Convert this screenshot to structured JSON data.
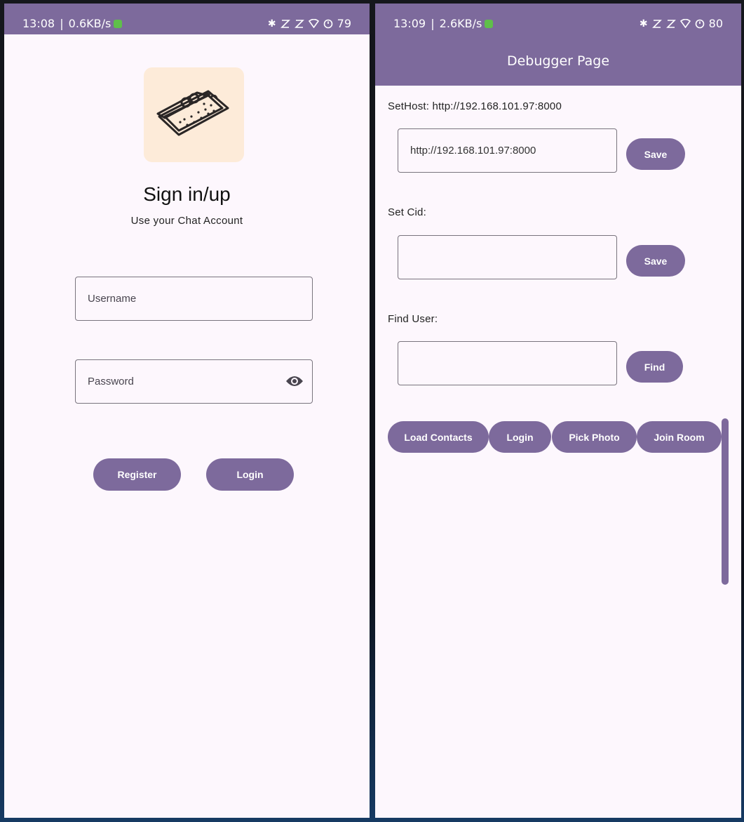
{
  "left_screen": {
    "status": {
      "time": "13:08",
      "speed": "0.6KB/s",
      "battery": "79"
    },
    "title": "Sign in/up",
    "subtitle": "Use your Chat Account",
    "username_placeholder": "Username",
    "password_placeholder": "Password",
    "buttons": {
      "register": "Register",
      "login": "Login"
    }
  },
  "right_screen": {
    "status": {
      "time": "13:09",
      "speed": "2.6KB/s",
      "battery": "80"
    },
    "appbar_title": "Debugger Page",
    "set_host": {
      "label": "SetHost: http://192.168.101.97:8000",
      "value": "http://192.168.101.97:8000",
      "button": "Save"
    },
    "set_cid": {
      "label": "Set Cid:",
      "value": "",
      "button": "Save"
    },
    "find_user": {
      "label": "Find User:",
      "value": "",
      "button": "Find"
    },
    "actions": [
      "Load Contacts",
      "Login",
      "Pick Photo",
      "Join Room"
    ]
  },
  "colors": {
    "primary": "#7d6a9c",
    "background": "#fdf7fd",
    "logo_bg": "#fdebd9"
  },
  "icons": [
    "bluetooth-icon",
    "alarm-icon",
    "wifi-icon",
    "timer-icon",
    "eye-icon",
    "food-tray-logo"
  ]
}
